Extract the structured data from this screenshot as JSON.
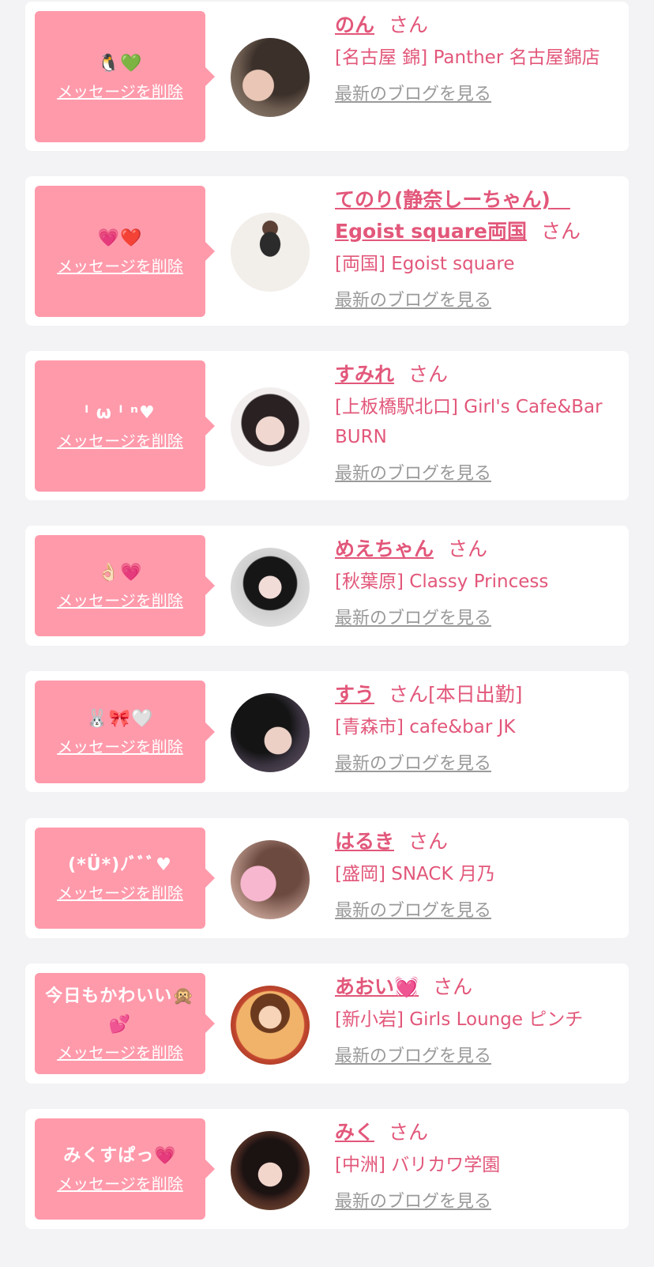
{
  "colors": {
    "bubble": "#ff9aab",
    "accent": "#e2577a",
    "muted": "#9a9a9a",
    "background": "#f3f2f4"
  },
  "delete_label": "メッセージを削除",
  "san_label": "さん",
  "blog_label": "最新のブログを見る",
  "entries": [
    {
      "message": "🐧💚",
      "name": "のん",
      "status": "",
      "shop": "[名古屋 錦] Panther 名古屋錦店",
      "avatar": "girl-photo"
    },
    {
      "message": "💗❤️",
      "name": "てのり(静奈しーちゃん)　Egoist square両国",
      "status": "",
      "shop": "[両国] Egoist square",
      "avatar": "girl-photo"
    },
    {
      "message": "ˡ ω ˡ ⁿ♥",
      "name": "すみれ",
      "status": "",
      "shop": "[上板橋駅北口] Girl's Cafe&Bar BURN",
      "avatar": "girl-photo"
    },
    {
      "message": "👌🏻💗",
      "name": "めえちゃん",
      "status": "",
      "shop": "[秋葉原] Classy Princess",
      "avatar": "girl-photo"
    },
    {
      "message": "🐰🎀🤍",
      "name": "すう",
      "status": "[本日出勤]",
      "shop": "[青森市] cafe&bar JK",
      "avatar": "girl-photo"
    },
    {
      "message": "(*Ü*)ﾉﾞﾞﾞ♥",
      "name": "はるき",
      "status": "",
      "shop": "[盛岡] SNACK 月乃",
      "avatar": "girl-photo"
    },
    {
      "message": "今日もかわいい🙊💕",
      "name": "あおい💓",
      "status": "",
      "shop": "[新小岩] Girls Lounge ピンチ",
      "avatar": "illustration"
    },
    {
      "message": "みくすぱっ💗",
      "name": "みく",
      "status": "",
      "shop": "[中洲] バリカワ学園",
      "avatar": "girl-photo"
    }
  ]
}
